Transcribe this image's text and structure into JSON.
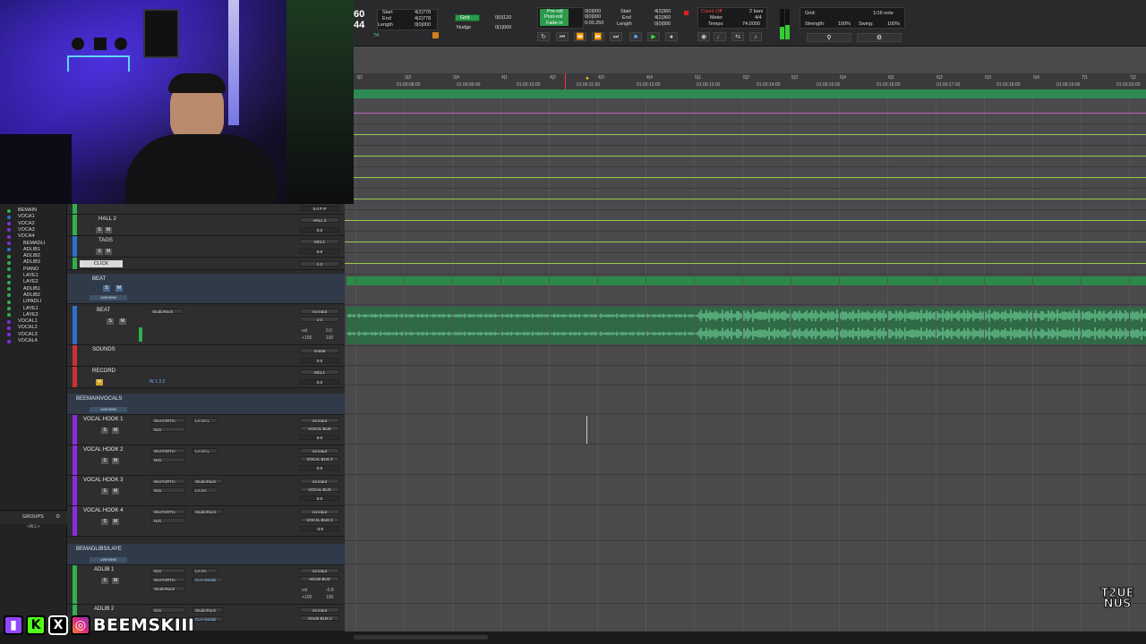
{
  "transport": {
    "counter_main": "60",
    "counter_sub": "44",
    "sel_labels": [
      "Start",
      "End",
      "Length"
    ],
    "sel_values": [
      "4|2|778",
      "4|2|778",
      "0|0|000"
    ],
    "mode": "Grid",
    "nudge_label": "Nudge",
    "grid_value": "0|0|120",
    "nudge_value": "0|1|000",
    "preroll_label": "Pre-roll",
    "postroll_label": "Post-roll",
    "fadein_label": "Fade-in",
    "preroll_values": [
      "0|0|000",
      "0|0|000",
      "0:00.250"
    ],
    "rec_labels": [
      "Start",
      "End",
      "Length"
    ],
    "rec_values": [
      "4|2|360",
      "4|2|360",
      "0|0|000"
    ],
    "countoff": "Count Off",
    "countoff_value": "2 bars",
    "meter_label": "Meter",
    "meter_value": "4/4",
    "tempo_label": "Tempo",
    "tempo_value": "74.0000",
    "grid_label": "Grid:",
    "grid_note": "1/16 note",
    "strength_label": "Strength:",
    "strength_value": "100%",
    "swing_label": "Swing:",
    "swing_value": "100%",
    "bpm_small": "74"
  },
  "left_list": {
    "items": [
      "BEMAIN",
      "VOCA1",
      "VOCA2",
      "VOCA3",
      "VOCA4",
      "BEMADLI",
      "ADLIB1",
      "ADLIB2",
      "ADLIB3",
      "PIANO",
      "LAYE1",
      "LAYE2",
      "ADLIB1",
      "ADLIB2",
      "LIPADLI",
      "LAYE1",
      "LAYE2",
      "VOCAL1",
      "VOCAL2",
      "VOCAL3",
      "VOCAL4"
    ],
    "groups_label": "GROUPS",
    "groups_all": "<ALL>"
  },
  "mixer": {
    "hall2": {
      "name": "HALL 2",
      "in": "HALL 2",
      "out": "ALE FX",
      "vol": "0.0"
    },
    "tags": {
      "name": "TAGS",
      "in": "MCL1",
      "out": "1-2",
      "vol": "0.0"
    },
    "click": {
      "name": "CLICK",
      "out": "1-2"
    },
    "beat_folder": {
      "name": "BEAT",
      "overview": "overview"
    },
    "beat": {
      "name": "BEAT",
      "insert": "StudioRack",
      "in": "no input",
      "out": "1-2",
      "vol_label": "vol",
      "vol": "0.0",
      "pan": "+100",
      "pan2": "100"
    },
    "sounds": {
      "name": "SOUNDS",
      "in": "nomat",
      "out": "1-2",
      "vol": "0.0"
    },
    "record": {
      "name": "RECORD",
      "in": "MCL1",
      "out": "VOC8",
      "vol": "0.0",
      "mini": "W 1 3 2"
    },
    "vocals_folder": {
      "name": "BEEMAINVOCALS",
      "overview": "overview"
    },
    "vocals": [
      {
        "name": "VOCAL HOOK 1",
        "i1": "WvsTnRTm",
        "i2": "LA-2A L",
        "i3": "N31",
        "in": "no input",
        "out": "VOCAL BUS",
        "vol": "0.0"
      },
      {
        "name": "VOCAL HOOK 2",
        "i1": "WvsTnRTm",
        "i2": "LA-2A L",
        "i3": "N31",
        "in": "no input",
        "out": "VOCAL BUS 2",
        "vol": "0.0"
      },
      {
        "name": "VOCAL HOOK 3",
        "i1": "WvsTnRTm",
        "i2": "StudioRack",
        "i3": "N31",
        "i4": "LA-2A",
        "in": "no input",
        "out": "VOCAL BUS",
        "vol": "0.0"
      },
      {
        "name": "VOCAL HOOK 4",
        "i1": "WvsTnRTm",
        "i2": "StudioRack",
        "i3": "N31",
        "in": "no input",
        "out": "VOCAL BUS 2",
        "vol": "-3.9"
      }
    ],
    "adlib_folder": {
      "name": "BEMADLIBS/LAYE",
      "overview": "overview"
    },
    "adlib1": {
      "name": "ADLIB 1",
      "i1": "N31",
      "i2": "LA-2A",
      "i3": "WvsTnRTm",
      "i4": "CLA Vocals",
      "i5": "StudioRack",
      "in": "no input",
      "out": "ADLIB BUS",
      "vol_label": "vol",
      "vol": "-0.8",
      "pan": "+100",
      "pan2": "100"
    },
    "adlib2": {
      "name": "ADLIB 2",
      "i1": "N31",
      "i2": "StudioRack",
      "i4": "CLA Vocals",
      "in": "no input",
      "out": "ADLIB BUS 2"
    }
  },
  "ruler": {
    "bars": [
      "3|2",
      "3|3",
      "3|4",
      "4|1",
      "4|2",
      "4|3",
      "4|4",
      "5|1",
      "5|2",
      "5|3",
      "5|4",
      "6|1",
      "6|2",
      "6|3",
      "6|4",
      "7|1",
      "7|2"
    ],
    "times": [
      "01:00:08:00",
      "01:00:09:00",
      "01:00:10:00",
      "01:00:11:00",
      "01:00:12:00",
      "01:00:13:00",
      "01:00:14:00",
      "01:00:15:00",
      "01:00:16:00",
      "01:00:17:00",
      "01:00:18:00",
      "01:00:19:00",
      "01:00:20:00"
    ]
  },
  "social": {
    "handle": "BEEMSKIII",
    "icons": [
      "twitch-icon",
      "kick-icon",
      "x-icon",
      "instagram-icon"
    ]
  },
  "logo": {
    "line1": "T2UE",
    "line2": "NUS"
  },
  "colors": {
    "green_clip": "#2f6a45",
    "wave": "#6fd09a",
    "accent_green": "#2b8a4a",
    "purple_track": "#8a2be2",
    "blue_track": "#2f6fd0",
    "red_track": "#d03030",
    "green_track": "#2fb04a",
    "ruler_bg": "#3a3a3c"
  }
}
